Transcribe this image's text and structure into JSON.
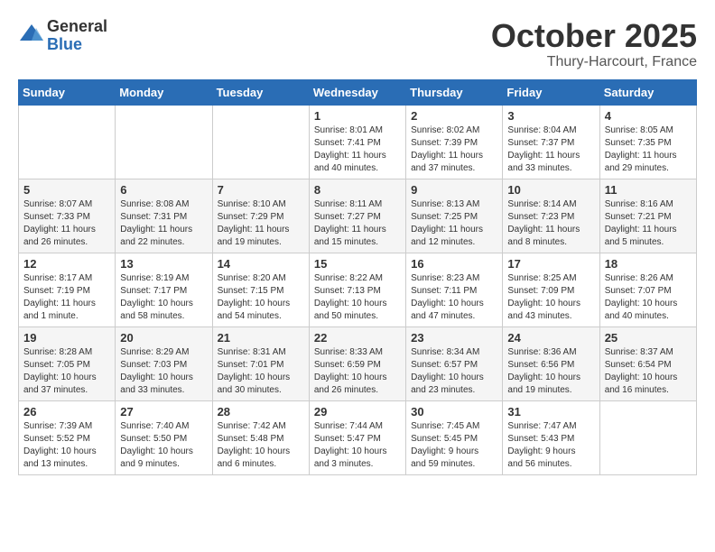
{
  "logo": {
    "general": "General",
    "blue": "Blue"
  },
  "title": {
    "month": "October 2025",
    "location": "Thury-Harcourt, France"
  },
  "headers": [
    "Sunday",
    "Monday",
    "Tuesday",
    "Wednesday",
    "Thursday",
    "Friday",
    "Saturday"
  ],
  "weeks": [
    [
      {
        "day": "",
        "info": ""
      },
      {
        "day": "",
        "info": ""
      },
      {
        "day": "",
        "info": ""
      },
      {
        "day": "1",
        "info": "Sunrise: 8:01 AM\nSunset: 7:41 PM\nDaylight: 11 hours\nand 40 minutes."
      },
      {
        "day": "2",
        "info": "Sunrise: 8:02 AM\nSunset: 7:39 PM\nDaylight: 11 hours\nand 37 minutes."
      },
      {
        "day": "3",
        "info": "Sunrise: 8:04 AM\nSunset: 7:37 PM\nDaylight: 11 hours\nand 33 minutes."
      },
      {
        "day": "4",
        "info": "Sunrise: 8:05 AM\nSunset: 7:35 PM\nDaylight: 11 hours\nand 29 minutes."
      }
    ],
    [
      {
        "day": "5",
        "info": "Sunrise: 8:07 AM\nSunset: 7:33 PM\nDaylight: 11 hours\nand 26 minutes."
      },
      {
        "day": "6",
        "info": "Sunrise: 8:08 AM\nSunset: 7:31 PM\nDaylight: 11 hours\nand 22 minutes."
      },
      {
        "day": "7",
        "info": "Sunrise: 8:10 AM\nSunset: 7:29 PM\nDaylight: 11 hours\nand 19 minutes."
      },
      {
        "day": "8",
        "info": "Sunrise: 8:11 AM\nSunset: 7:27 PM\nDaylight: 11 hours\nand 15 minutes."
      },
      {
        "day": "9",
        "info": "Sunrise: 8:13 AM\nSunset: 7:25 PM\nDaylight: 11 hours\nand 12 minutes."
      },
      {
        "day": "10",
        "info": "Sunrise: 8:14 AM\nSunset: 7:23 PM\nDaylight: 11 hours\nand 8 minutes."
      },
      {
        "day": "11",
        "info": "Sunrise: 8:16 AM\nSunset: 7:21 PM\nDaylight: 11 hours\nand 5 minutes."
      }
    ],
    [
      {
        "day": "12",
        "info": "Sunrise: 8:17 AM\nSunset: 7:19 PM\nDaylight: 11 hours\nand 1 minute."
      },
      {
        "day": "13",
        "info": "Sunrise: 8:19 AM\nSunset: 7:17 PM\nDaylight: 10 hours\nand 58 minutes."
      },
      {
        "day": "14",
        "info": "Sunrise: 8:20 AM\nSunset: 7:15 PM\nDaylight: 10 hours\nand 54 minutes."
      },
      {
        "day": "15",
        "info": "Sunrise: 8:22 AM\nSunset: 7:13 PM\nDaylight: 10 hours\nand 50 minutes."
      },
      {
        "day": "16",
        "info": "Sunrise: 8:23 AM\nSunset: 7:11 PM\nDaylight: 10 hours\nand 47 minutes."
      },
      {
        "day": "17",
        "info": "Sunrise: 8:25 AM\nSunset: 7:09 PM\nDaylight: 10 hours\nand 43 minutes."
      },
      {
        "day": "18",
        "info": "Sunrise: 8:26 AM\nSunset: 7:07 PM\nDaylight: 10 hours\nand 40 minutes."
      }
    ],
    [
      {
        "day": "19",
        "info": "Sunrise: 8:28 AM\nSunset: 7:05 PM\nDaylight: 10 hours\nand 37 minutes."
      },
      {
        "day": "20",
        "info": "Sunrise: 8:29 AM\nSunset: 7:03 PM\nDaylight: 10 hours\nand 33 minutes."
      },
      {
        "day": "21",
        "info": "Sunrise: 8:31 AM\nSunset: 7:01 PM\nDaylight: 10 hours\nand 30 minutes."
      },
      {
        "day": "22",
        "info": "Sunrise: 8:33 AM\nSunset: 6:59 PM\nDaylight: 10 hours\nand 26 minutes."
      },
      {
        "day": "23",
        "info": "Sunrise: 8:34 AM\nSunset: 6:57 PM\nDaylight: 10 hours\nand 23 minutes."
      },
      {
        "day": "24",
        "info": "Sunrise: 8:36 AM\nSunset: 6:56 PM\nDaylight: 10 hours\nand 19 minutes."
      },
      {
        "day": "25",
        "info": "Sunrise: 8:37 AM\nSunset: 6:54 PM\nDaylight: 10 hours\nand 16 minutes."
      }
    ],
    [
      {
        "day": "26",
        "info": "Sunrise: 7:39 AM\nSunset: 5:52 PM\nDaylight: 10 hours\nand 13 minutes."
      },
      {
        "day": "27",
        "info": "Sunrise: 7:40 AM\nSunset: 5:50 PM\nDaylight: 10 hours\nand 9 minutes."
      },
      {
        "day": "28",
        "info": "Sunrise: 7:42 AM\nSunset: 5:48 PM\nDaylight: 10 hours\nand 6 minutes."
      },
      {
        "day": "29",
        "info": "Sunrise: 7:44 AM\nSunset: 5:47 PM\nDaylight: 10 hours\nand 3 minutes."
      },
      {
        "day": "30",
        "info": "Sunrise: 7:45 AM\nSunset: 5:45 PM\nDaylight: 9 hours\nand 59 minutes."
      },
      {
        "day": "31",
        "info": "Sunrise: 7:47 AM\nSunset: 5:43 PM\nDaylight: 9 hours\nand 56 minutes."
      },
      {
        "day": "",
        "info": ""
      }
    ]
  ]
}
